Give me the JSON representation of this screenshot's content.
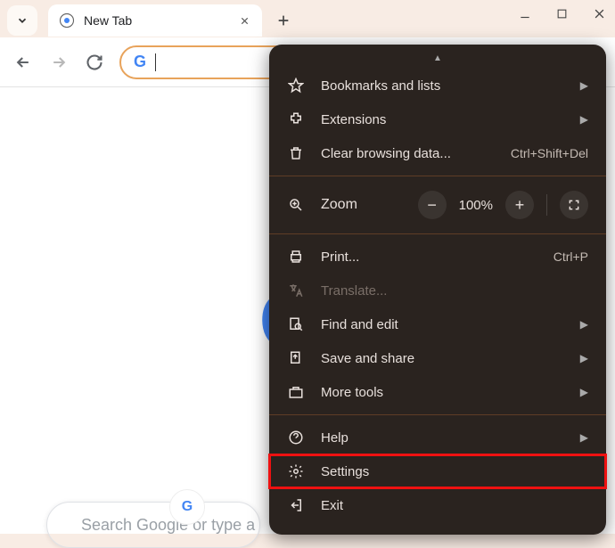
{
  "tab": {
    "title": "New Tab"
  },
  "search": {
    "placeholder": "Search Google or type a URL"
  },
  "zoom": {
    "label": "Zoom",
    "value": "100%"
  },
  "menu": {
    "bookmarks": "Bookmarks and lists",
    "extensions": "Extensions",
    "clear_data": "Clear browsing data...",
    "clear_data_shortcut": "Ctrl+Shift+Del",
    "print": "Print...",
    "print_shortcut": "Ctrl+P",
    "translate": "Translate...",
    "find": "Find and edit",
    "save_share": "Save and share",
    "more_tools": "More tools",
    "help": "Help",
    "settings": "Settings",
    "exit": "Exit"
  }
}
